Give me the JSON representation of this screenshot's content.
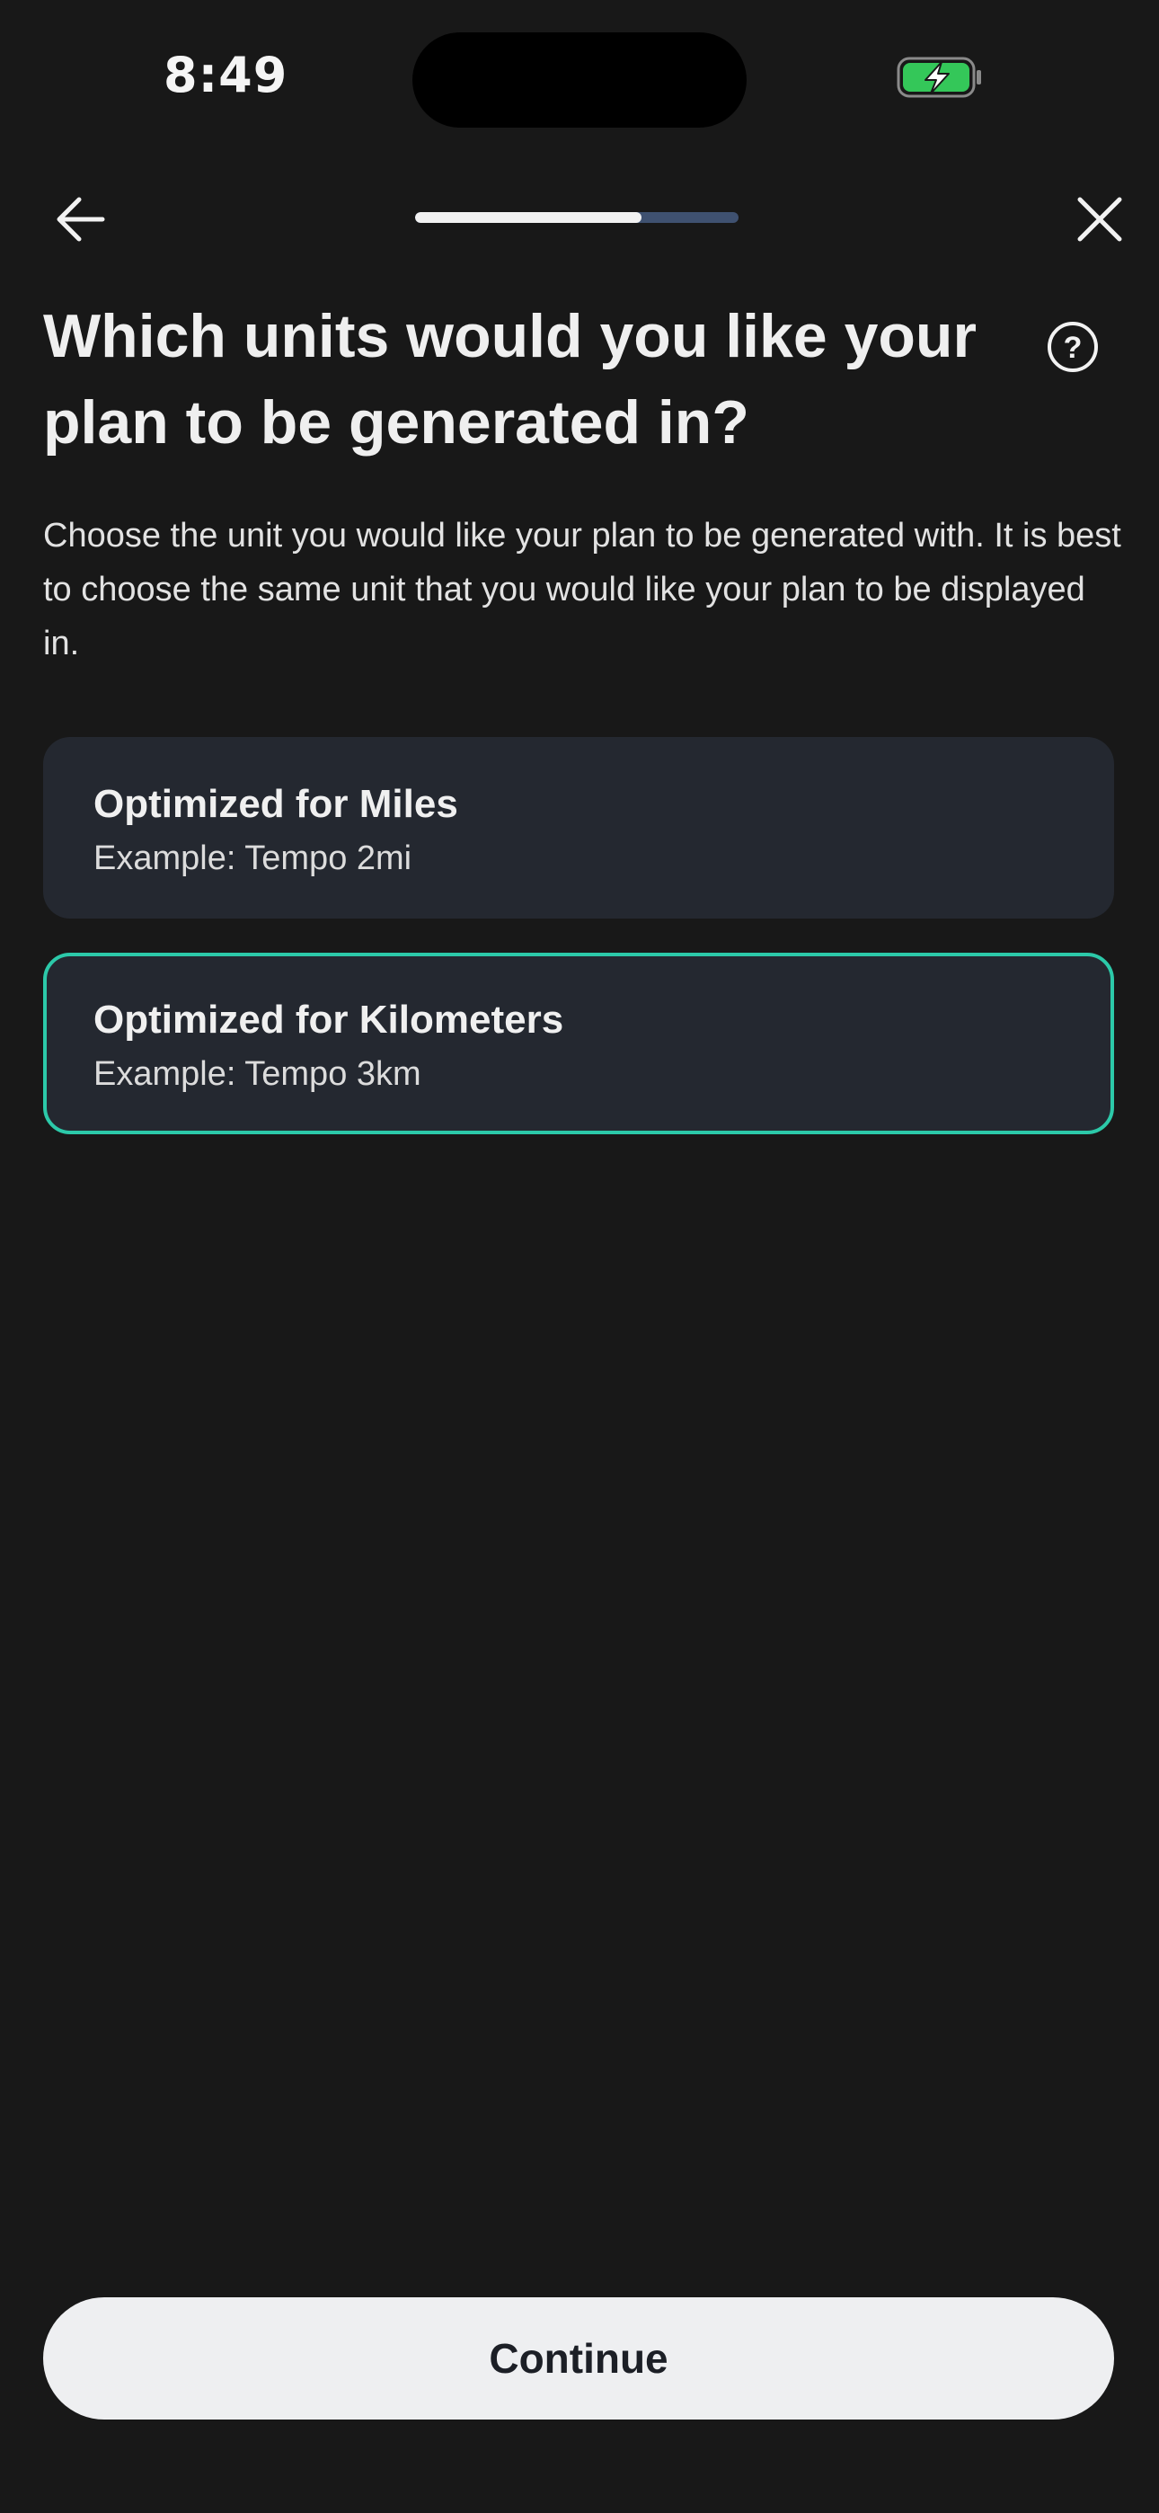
{
  "status_bar": {
    "time": "8:49",
    "battery_icon": "battery-charging-icon",
    "battery_color": "#34c759"
  },
  "nav": {
    "back_icon": "arrow-left-icon",
    "close_icon": "close-icon",
    "progress": 0.7
  },
  "question": {
    "title": "Which units would you like your plan to be generated in?",
    "help_icon": "question-circle-icon",
    "description": "Choose the unit you would like your plan to be generated with. It is best to choose the same unit that you would like your plan to be displayed in."
  },
  "options": [
    {
      "title": "Optimized for Miles",
      "example": "Example: Tempo 2mi",
      "selected": false
    },
    {
      "title": "Optimized for Kilometers",
      "example": "Example: Tempo 3km",
      "selected": true
    }
  ],
  "colors": {
    "background": "#181818",
    "card": "#242830",
    "selected_border": "#2cc9a9",
    "progress_track": "#3f5170",
    "button_bg": "#eeeff1"
  },
  "continue_label": "Continue"
}
